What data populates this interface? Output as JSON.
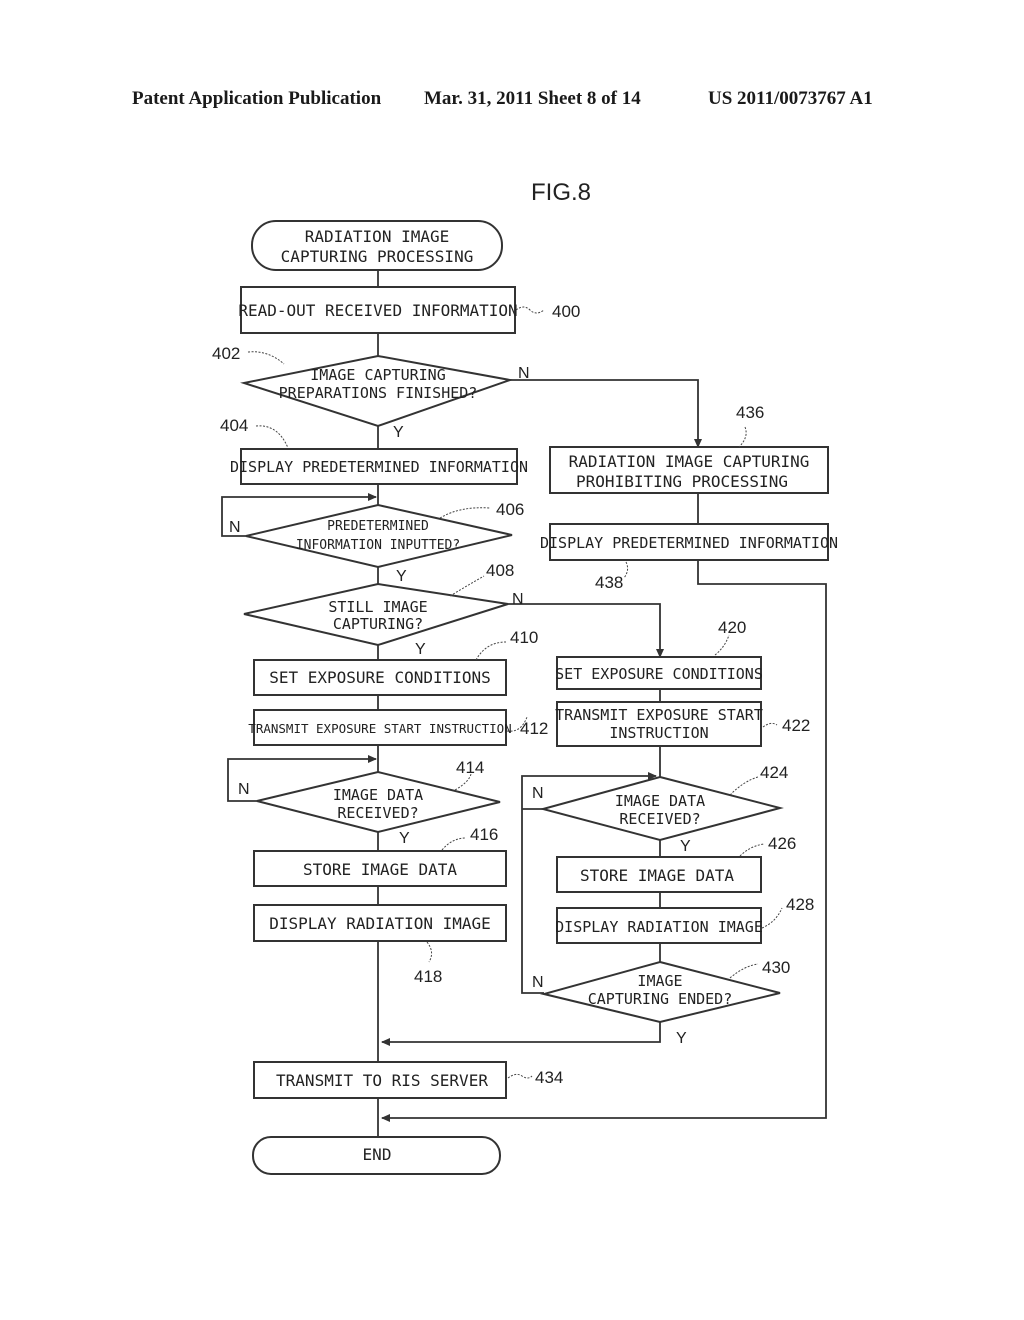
{
  "header": {
    "publication": "Patent Application Publication",
    "date_sheet": "Mar. 31, 2011  Sheet 8 of 14",
    "patent_number": "US 2011/0073767 A1"
  },
  "figure": {
    "label": "FIG.8",
    "start": {
      "line1": "RADIATION IMAGE",
      "line2": "CAPTURING PROCESSING"
    },
    "end": {
      "label": "END"
    },
    "steps": {
      "s400": {
        "ref": "400",
        "text": "READ-OUT RECEIVED INFORMATION"
      },
      "s402": {
        "ref": "402",
        "line1": "IMAGE CAPTURING",
        "line2": "PREPARATIONS FINISHED?"
      },
      "s404": {
        "ref": "404",
        "text": "DISPLAY PREDETERMINED INFORMATION"
      },
      "s406": {
        "ref": "406",
        "line1": "PREDETERMINED",
        "line2": "INFORMATION INPUTTED?"
      },
      "s408": {
        "ref": "408",
        "line1": "STILL IMAGE",
        "line2": "CAPTURING?"
      },
      "s410": {
        "ref": "410",
        "text": "SET EXPOSURE CONDITIONS"
      },
      "s412": {
        "ref": "412",
        "text": "TRANSMIT EXPOSURE START INSTRUCTION"
      },
      "s414": {
        "ref": "414",
        "line1": "IMAGE DATA",
        "line2": "RECEIVED?"
      },
      "s416": {
        "ref": "416",
        "text": "STORE IMAGE DATA"
      },
      "s418": {
        "ref": "418",
        "text": "DISPLAY RADIATION IMAGE"
      },
      "s420": {
        "ref": "420",
        "text": "SET EXPOSURE CONDITIONS"
      },
      "s422": {
        "ref": "422",
        "line1": "TRANSMIT EXPOSURE START",
        "line2": "INSTRUCTION"
      },
      "s424": {
        "ref": "424",
        "line1": "IMAGE DATA",
        "line2": "RECEIVED?"
      },
      "s426": {
        "ref": "426",
        "text": "STORE IMAGE DATA"
      },
      "s428": {
        "ref": "428",
        "text": "DISPLAY RADIATION IMAGE"
      },
      "s430": {
        "ref": "430",
        "line1": "IMAGE",
        "line2": "CAPTURING ENDED?"
      },
      "s434": {
        "ref": "434",
        "text": "TRANSMIT TO RIS SERVER"
      },
      "s436": {
        "ref": "436",
        "line1": "RADIATION IMAGE CAPTURING",
        "line2": "PROHIBITING PROCESSING"
      },
      "s438": {
        "ref": "438",
        "text": "DISPLAY PREDETERMINED INFORMATION"
      }
    },
    "branch_labels": {
      "yes": "Y",
      "no": "N"
    }
  }
}
